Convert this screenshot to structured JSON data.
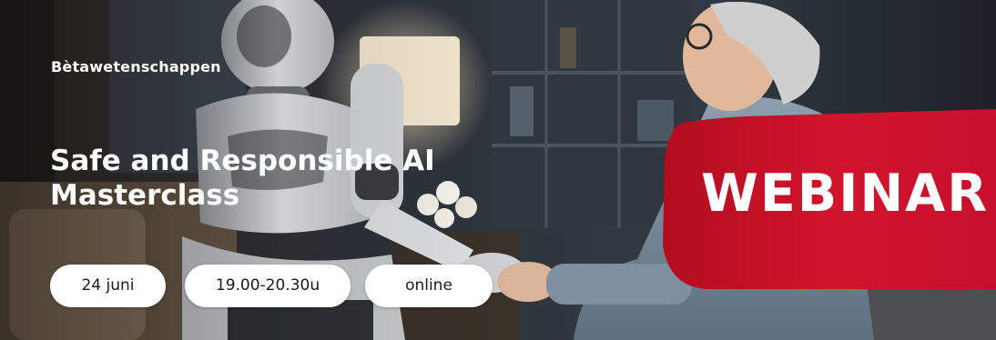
{
  "banner": {
    "category": "Bètawetenschappen",
    "title_line1": "Safe and Responsible AI",
    "title_line2": "Masterclass",
    "pills": {
      "date": "24 juni",
      "time": "19.00-20.30u",
      "location": "online"
    },
    "webinar_label": "WEBINAR"
  },
  "colors": {
    "accent_red": "#c8102e",
    "text_light": "#ffffff",
    "pill_bg": "#ffffff"
  },
  "icons": {
    "photo": "robot-and-elderly-woman-photo"
  }
}
